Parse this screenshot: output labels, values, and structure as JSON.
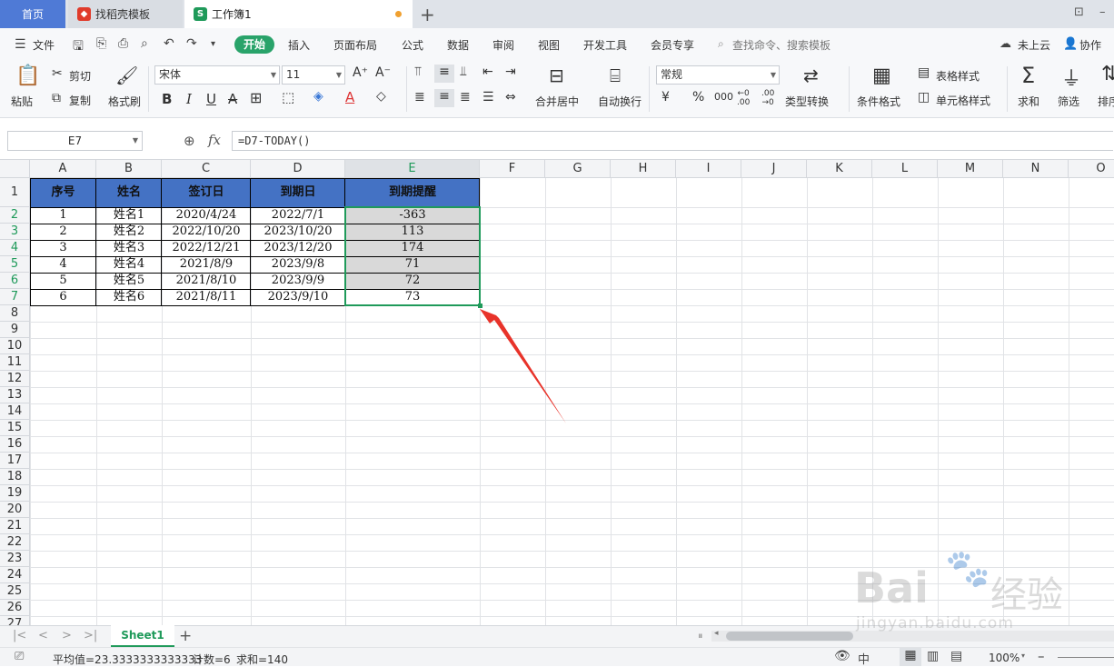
{
  "tabs": {
    "home": "首页",
    "template": "找稻壳模板",
    "workbook": "工作簿1",
    "new_tab": "+"
  },
  "menubar": {
    "file": "文件",
    "items": [
      "开始",
      "插入",
      "页面布局",
      "公式",
      "数据",
      "审阅",
      "视图",
      "开发工具",
      "会员专享"
    ],
    "search": "查找命令、搜索模板",
    "cloud": "未上云",
    "collab": "协作"
  },
  "ribbon": {
    "paste": "粘贴",
    "cut": "剪切",
    "copy": "复制",
    "format_painter": "格式刷",
    "font_name": "宋体",
    "font_size": "11",
    "merge_center": "合并居中",
    "wrap_text": "自动换行",
    "number_format": "常规",
    "type_convert": "类型转换",
    "cond_format": "条件格式",
    "table_style": "表格样式",
    "cell_style": "单元格样式",
    "sum": "求和",
    "filter": "筛选",
    "sort": "排序"
  },
  "formula_bar": {
    "name_box": "E7",
    "fx": "fx",
    "formula": "=D7-TODAY()"
  },
  "columns": [
    "A",
    "B",
    "C",
    "D",
    "E",
    "F",
    "G",
    "H",
    "I",
    "J",
    "K",
    "L",
    "M",
    "N",
    "O"
  ],
  "rows": [
    "1",
    "2",
    "3",
    "4",
    "5",
    "6",
    "7",
    "8",
    "9",
    "10",
    "11",
    "12",
    "13",
    "14",
    "15",
    "16",
    "17",
    "18",
    "19",
    "20",
    "21",
    "22",
    "23",
    "24",
    "25",
    "26",
    "27"
  ],
  "table": {
    "headers": [
      "序号",
      "姓名",
      "签订日",
      "到期日",
      "到期提醒"
    ],
    "data": [
      [
        "1",
        "姓名1",
        "2020/4/24",
        "2022/7/1",
        "-363"
      ],
      [
        "2",
        "姓名2",
        "2022/10/20",
        "2023/10/20",
        "113"
      ],
      [
        "3",
        "姓名3",
        "2022/12/21",
        "2023/12/20",
        "174"
      ],
      [
        "4",
        "姓名4",
        "2021/8/9",
        "2023/9/8",
        "71"
      ],
      [
        "5",
        "姓名5",
        "2021/8/10",
        "2023/9/9",
        "72"
      ],
      [
        "6",
        "姓名6",
        "2021/8/11",
        "2023/9/10",
        "73"
      ]
    ]
  },
  "sheet": {
    "name": "Sheet1"
  },
  "status": {
    "average": "平均值=23.3333333333333",
    "count": "计数=6",
    "sum": "求和=140",
    "zoom": "100%"
  },
  "colors": {
    "accent": "#29a36a",
    "header_fill": "#4472c4",
    "selection": "#1f9a5a",
    "arrow": "#e8332a"
  }
}
